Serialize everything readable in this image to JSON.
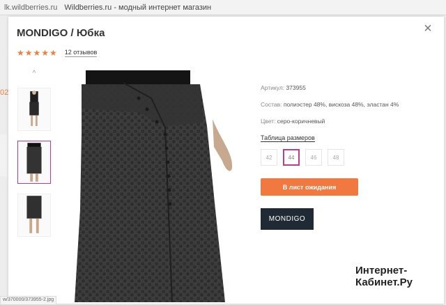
{
  "browser": {
    "domain": "lk.wildberries.ru",
    "title": "Wildberries.ru - модный интернет магазин"
  },
  "product": {
    "title": "MONDIGO / Юбка",
    "stars": "★★★★★",
    "reviews": "12 отзывов",
    "article_label": "Артикул:",
    "article_value": "373955",
    "composition_label": "Состав:",
    "composition_value": "полиэстер 48%, вискоза 48%, эластан 4%",
    "color_label": "Цвет:",
    "color_value": "серо-коричневый",
    "size_table": "Таблица размеров",
    "sizes": [
      "42",
      "44",
      "46",
      "48"
    ],
    "selected_size": "44",
    "wait_button": "В лист ожидания",
    "brand_logo": "MONDIGO",
    "rating": 5
  },
  "status": {
    "url": "w/370000/373955-2.jpg"
  },
  "watermark": {
    "line1": "Интернет-",
    "line2": "Кабинет.Ру"
  },
  "colors": {
    "accent": "#f1783f",
    "selected_border": "#c23a8f",
    "logo_bg": "#1f2a35"
  },
  "icons": {
    "close": "close-icon",
    "thumb_up": "chevron-up-icon"
  }
}
